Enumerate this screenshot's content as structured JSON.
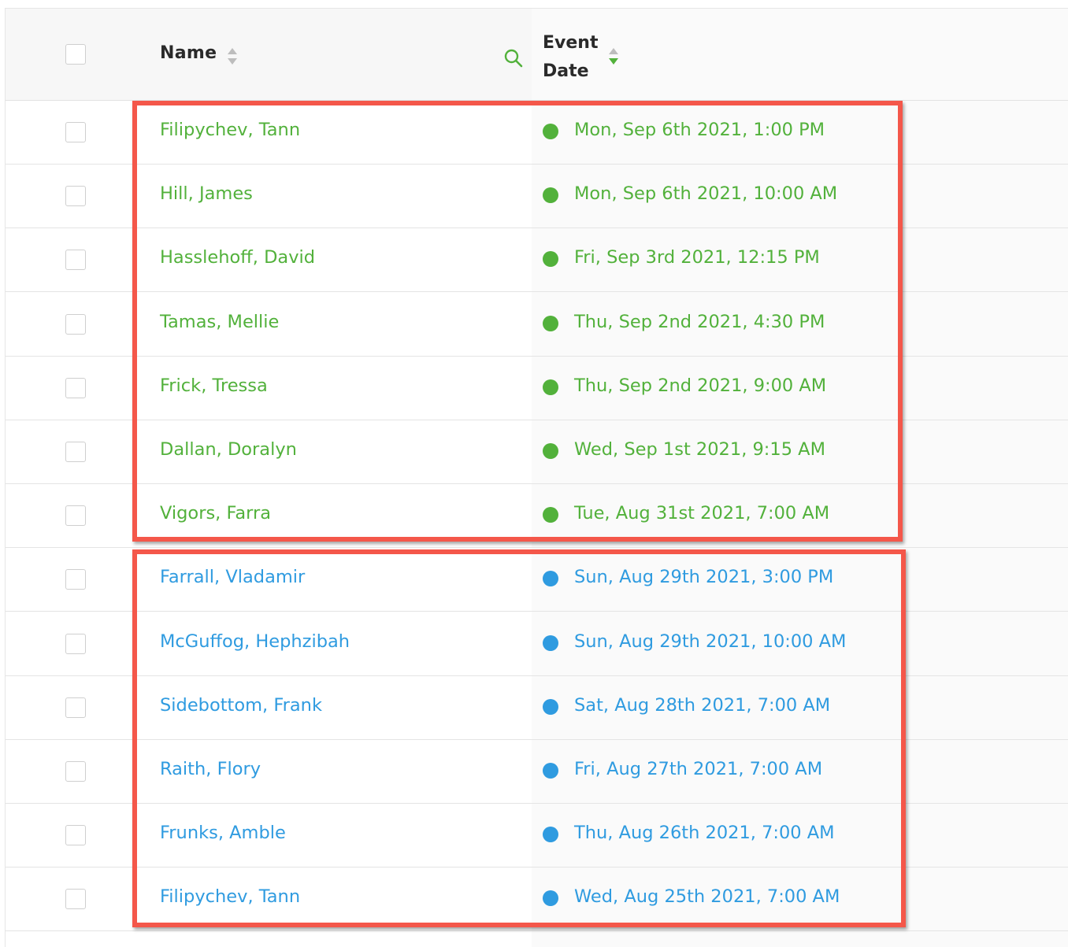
{
  "table": {
    "header": {
      "name_label": "Name",
      "event_date_label_line1": "Event",
      "event_date_label_line2": "Date"
    },
    "colors": {
      "upcoming": "#52b13b",
      "past": "#2f9be0",
      "highlight": "#f4574a"
    },
    "rows": [
      {
        "name": "Filipychev, Tann",
        "date": "Mon, Sep 6th 2021, 1:00 PM",
        "status": "green"
      },
      {
        "name": "Hill, James",
        "date": "Mon, Sep 6th 2021, 10:00 AM",
        "status": "green"
      },
      {
        "name": "Hasslehoff, David",
        "date": "Fri, Sep 3rd 2021, 12:15 PM",
        "status": "green"
      },
      {
        "name": "Tamas, Mellie",
        "date": "Thu, Sep 2nd 2021, 4:30 PM",
        "status": "green"
      },
      {
        "name": "Frick, Tressa",
        "date": "Thu, Sep 2nd 2021, 9:00 AM",
        "status": "green"
      },
      {
        "name": "Dallan, Doralyn",
        "date": "Wed, Sep 1st 2021, 9:15 AM",
        "status": "green"
      },
      {
        "name": "Vigors, Farra",
        "date": "Tue, Aug 31st 2021, 7:00 AM",
        "status": "green"
      },
      {
        "name": "Farrall, Vladamir",
        "date": "Sun, Aug 29th 2021, 3:00 PM",
        "status": "blue"
      },
      {
        "name": "McGuffog, Hephzibah",
        "date": "Sun, Aug 29th 2021, 10:00 AM",
        "status": "blue"
      },
      {
        "name": "Sidebottom, Frank",
        "date": "Sat, Aug 28th 2021, 7:00 AM",
        "status": "blue"
      },
      {
        "name": "Raith, Flory",
        "date": "Fri, Aug 27th 2021, 7:00 AM",
        "status": "blue"
      },
      {
        "name": "Frunks, Amble",
        "date": "Thu, Aug 26th 2021, 7:00 AM",
        "status": "blue"
      },
      {
        "name": "Filipychev, Tann",
        "date": "Wed, Aug 25th 2021, 7:00 AM",
        "status": "blue"
      }
    ]
  }
}
